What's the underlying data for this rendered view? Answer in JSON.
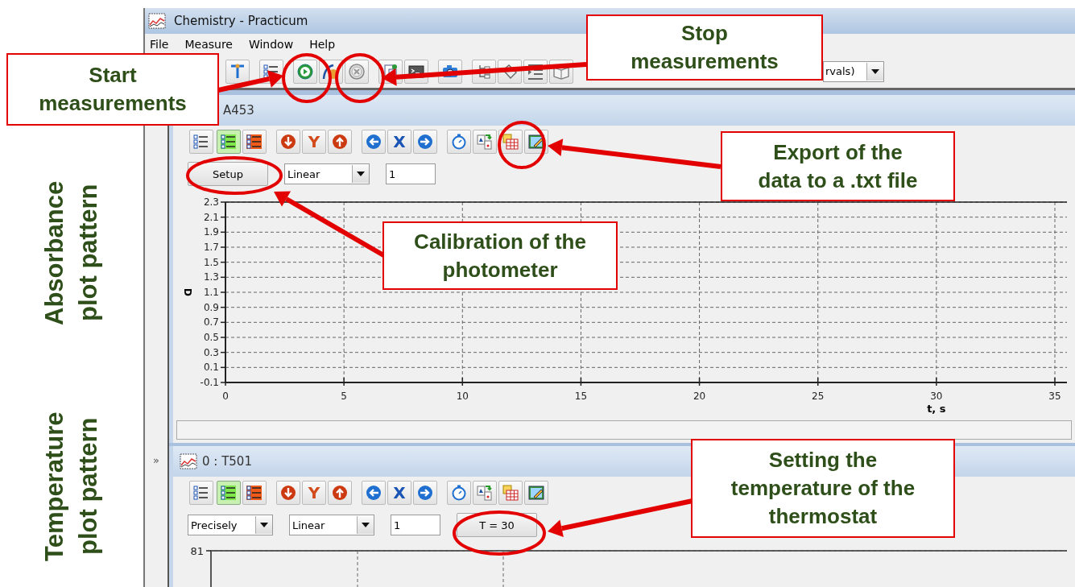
{
  "side_labels": [
    {
      "text": "Absorbance plot pattern"
    },
    {
      "text": "Temperature plot pattern"
    }
  ],
  "window": {
    "title": "Chemistry - Practicum"
  },
  "menu": [
    "File",
    "Measure",
    "Window",
    "Help"
  ],
  "toolbar": {
    "mode_dropdown": "rvals)"
  },
  "sidebar_toggle": "»",
  "panels": [
    {
      "title": "A453",
      "view_modes": [
        {
          "selected": false
        },
        {
          "selected": true
        },
        {
          "selected": false
        }
      ],
      "y_axis_button": "Y",
      "x_axis_button": "X",
      "controls": [
        {
          "kind": "button",
          "label": "Setup"
        },
        {
          "kind": "dropdown",
          "value": "Linear"
        },
        {
          "kind": "input",
          "value": "1"
        }
      ],
      "chart_data": {
        "type": "line",
        "xlabel": "t, s",
        "ylabel": "D",
        "grid": true,
        "xlim": [
          0,
          35
        ],
        "ylim": [
          -0.1,
          2.3
        ],
        "xticks": [
          0,
          5,
          10,
          15,
          20,
          25,
          30,
          35
        ],
        "yticks": [
          -0.1,
          0.1,
          0.3,
          0.5,
          0.7,
          0.9,
          1.1,
          1.3,
          1.5,
          1.7,
          1.9,
          2.1,
          2.3
        ]
      }
    },
    {
      "title": "0 : T501",
      "view_modes": [
        {
          "selected": false
        },
        {
          "selected": true
        },
        {
          "selected": false
        }
      ],
      "y_axis_button": "Y",
      "x_axis_button": "X",
      "controls": [
        {
          "kind": "dropdown",
          "value": "Precisely"
        },
        {
          "kind": "dropdown",
          "value": "Linear"
        },
        {
          "kind": "input",
          "value": "1"
        },
        {
          "kind": "button",
          "label": "T = 30"
        }
      ],
      "y_tick_label": "81"
    }
  ],
  "callouts": [
    {
      "lines": [
        "Start",
        "measurements"
      ]
    },
    {
      "lines": [
        "Stop",
        "measurements"
      ]
    },
    {
      "lines": [
        "Export of the",
        "data to a .txt file"
      ]
    },
    {
      "lines": [
        "Calibration of the",
        "photometer"
      ]
    },
    {
      "lines": [
        "Setting the",
        "temperature of the",
        "thermostat"
      ]
    }
  ]
}
